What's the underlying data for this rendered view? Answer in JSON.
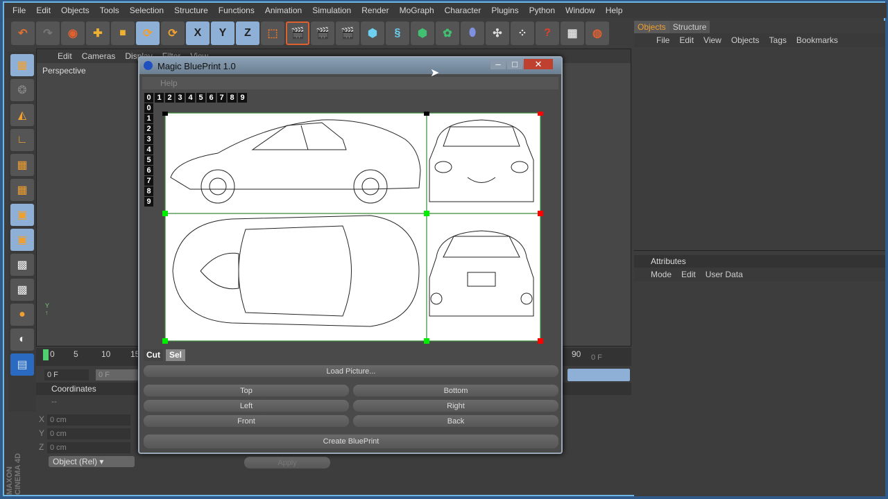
{
  "menu": [
    "File",
    "Edit",
    "Objects",
    "Tools",
    "Selection",
    "Structure",
    "Functions",
    "Animation",
    "Simulation",
    "Render",
    "MoGraph",
    "Character",
    "Plugins",
    "Python",
    "Window",
    "Help"
  ],
  "toolbar": {
    "axis": [
      "X",
      "Y",
      "Z"
    ]
  },
  "viewport": {
    "menu": [
      "Edit",
      "Cameras",
      "Display",
      "Filter",
      "View"
    ],
    "label": "Perspective"
  },
  "right": {
    "tabs": [
      "Objects",
      "Structure"
    ],
    "menu": [
      "File",
      "Edit",
      "View",
      "Objects",
      "Tags",
      "Bookmarks"
    ],
    "attributes_title": "Attributes",
    "attributes_menu": [
      "Mode",
      "Edit",
      "User Data"
    ]
  },
  "timeline": {
    "ticks": [
      "0",
      "5",
      "10",
      "15"
    ],
    "end_tick": "90",
    "frame": "0 F",
    "frame2": "0 F",
    "frame_end": "0 F"
  },
  "coords": {
    "title": "Coordinates",
    "dash": "--",
    "rows": [
      {
        "axis": "X",
        "value": "0 cm"
      },
      {
        "axis": "Y",
        "value": "0 cm"
      },
      {
        "axis": "Z",
        "value": "0 cm"
      }
    ],
    "mode": "Object (Rel)",
    "apply": "Apply"
  },
  "brand": "MAXON CINEMA 4D",
  "dialog": {
    "title": "Magic BluePrint 1.0",
    "help": "Help",
    "col_numbers": [
      "0",
      "1",
      "2",
      "3",
      "4",
      "5",
      "6",
      "7",
      "8",
      "9"
    ],
    "row_numbers": [
      "0",
      "1",
      "2",
      "3",
      "4",
      "5",
      "6",
      "7",
      "8",
      "9"
    ],
    "cut": "Cut",
    "sel": "Sel",
    "load": "Load Picture...",
    "top": "Top",
    "bottom": "Bottom",
    "left": "Left",
    "right": "Right",
    "front": "Front",
    "back": "Back",
    "create": "Create BluePrint"
  }
}
